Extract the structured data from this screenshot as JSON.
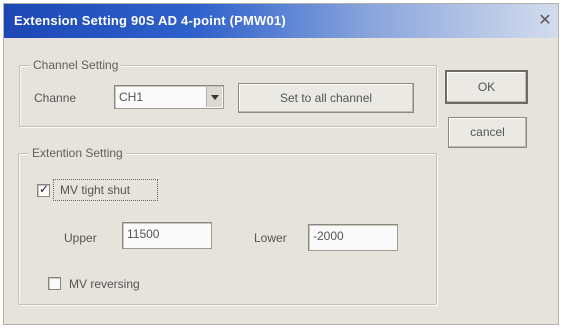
{
  "window": {
    "title": "Extension Setting 90S AD 4-point (PMW01)",
    "close_glyph": "✕"
  },
  "channel_group": {
    "title": "Channel Setting",
    "channel_label": "Channe",
    "channel_value": "CH1",
    "set_all_label": "Set to all channel"
  },
  "buttons": {
    "ok_label": "OK",
    "cancel_label": "cancel"
  },
  "extension_group": {
    "title": "Extention Setting",
    "tight_shut": {
      "label": "MV tight shut",
      "checked": true
    },
    "upper_label": "Upper",
    "upper_value": "11500",
    "lower_label": "Lower",
    "lower_value": "-2000",
    "reversing": {
      "label": "MV reversing",
      "checked": false
    }
  },
  "icons": {
    "check": "✓"
  }
}
